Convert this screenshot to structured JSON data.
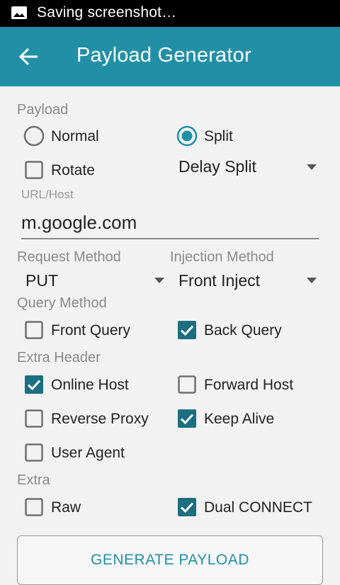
{
  "status_bar": {
    "text": "Saving screenshot…",
    "icon": "image-icon"
  },
  "app_bar": {
    "title": "Payload Generator",
    "back_icon": "arrow-back-icon"
  },
  "colors": {
    "accent": "#2190a6",
    "check_fill": "#1c6f80"
  },
  "payload": {
    "label": "Payload",
    "normal": {
      "label": "Normal",
      "selected": false
    },
    "split": {
      "label": "Split",
      "selected": true
    },
    "rotate": {
      "label": "Rotate",
      "checked": false
    },
    "split_mode": "Delay Split"
  },
  "url_host": {
    "label": "URL/Host",
    "value": "m.google.com"
  },
  "request_method": {
    "label": "Request Method",
    "value": "PUT"
  },
  "injection_method": {
    "label": "Injection Method",
    "value": "Front Inject"
  },
  "query_method": {
    "label": "Query Method",
    "front_query": {
      "label": "Front Query",
      "checked": false
    },
    "back_query": {
      "label": "Back Query",
      "checked": true
    }
  },
  "extra_header": {
    "label": "Extra Header",
    "online_host": {
      "label": "Online Host",
      "checked": true
    },
    "forward_host": {
      "label": "Forward Host",
      "checked": false
    },
    "reverse_proxy": {
      "label": "Reverse Proxy",
      "checked": false
    },
    "keep_alive": {
      "label": "Keep Alive",
      "checked": true
    },
    "user_agent": {
      "label": "User Agent",
      "checked": false
    }
  },
  "extra": {
    "label": "Extra",
    "raw": {
      "label": "Raw",
      "checked": false
    },
    "dual_connect": {
      "label": "Dual CONNECT",
      "checked": true
    }
  },
  "generate_button": {
    "label": "GENERATE PAYLOAD"
  }
}
